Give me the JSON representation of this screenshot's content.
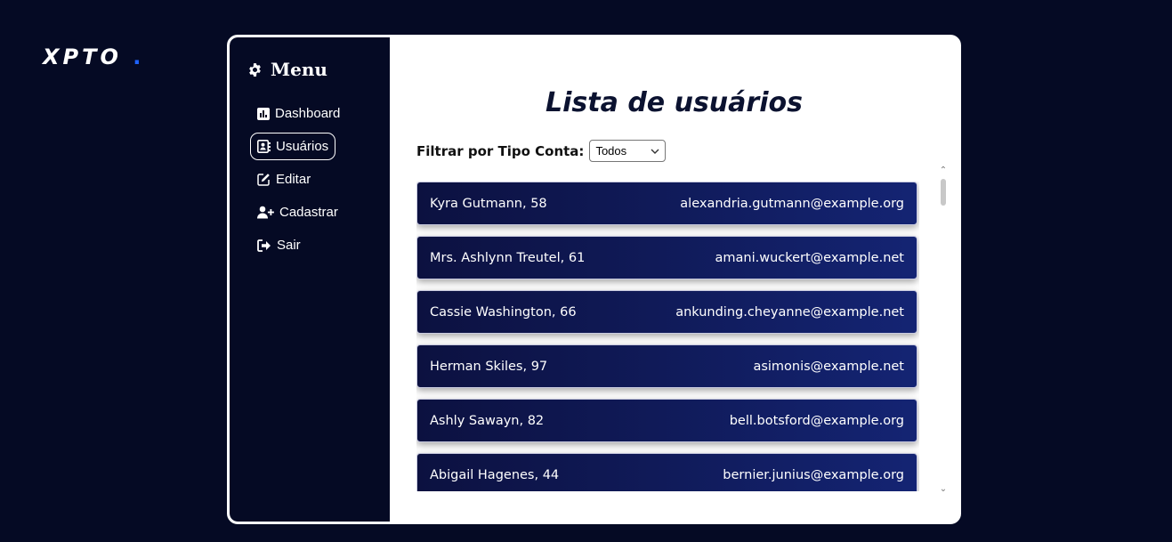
{
  "brand": {
    "name": "XPTO",
    "dot": ".",
    "accent_color": "#1e63ff"
  },
  "sidebar": {
    "title": "Menu",
    "title_icon": "gear-icon",
    "items": [
      {
        "label": "Dashboard",
        "icon": "chart-icon",
        "active": false
      },
      {
        "label": "Usuários",
        "icon": "contacts-icon",
        "active": true
      },
      {
        "label": "Editar",
        "icon": "edit-icon",
        "active": false
      },
      {
        "label": "Cadastrar",
        "icon": "user-plus-icon",
        "active": false
      },
      {
        "label": "Sair",
        "icon": "logout-icon",
        "active": false
      }
    ]
  },
  "main": {
    "title": "Lista de usuários",
    "filter": {
      "label": "Filtrar por Tipo Conta:",
      "selected": "Todos"
    },
    "users": [
      {
        "name_age": "Kyra Gutmann, 58",
        "email": "alexandria.gutmann@example.org"
      },
      {
        "name_age": "Mrs. Ashlynn Treutel, 61",
        "email": "amani.wuckert@example.net"
      },
      {
        "name_age": "Cassie Washington, 66",
        "email": "ankunding.cheyanne@example.net"
      },
      {
        "name_age": "Herman Skiles, 97",
        "email": "asimonis@example.net"
      },
      {
        "name_age": "Ashly Sawayn, 82",
        "email": "bell.botsford@example.org"
      },
      {
        "name_age": "Abigail Hagenes, 44",
        "email": "bernier.junius@example.org"
      }
    ]
  },
  "colors": {
    "background": "#050a24",
    "card_start": "#0c1140",
    "card_end": "#142473"
  }
}
